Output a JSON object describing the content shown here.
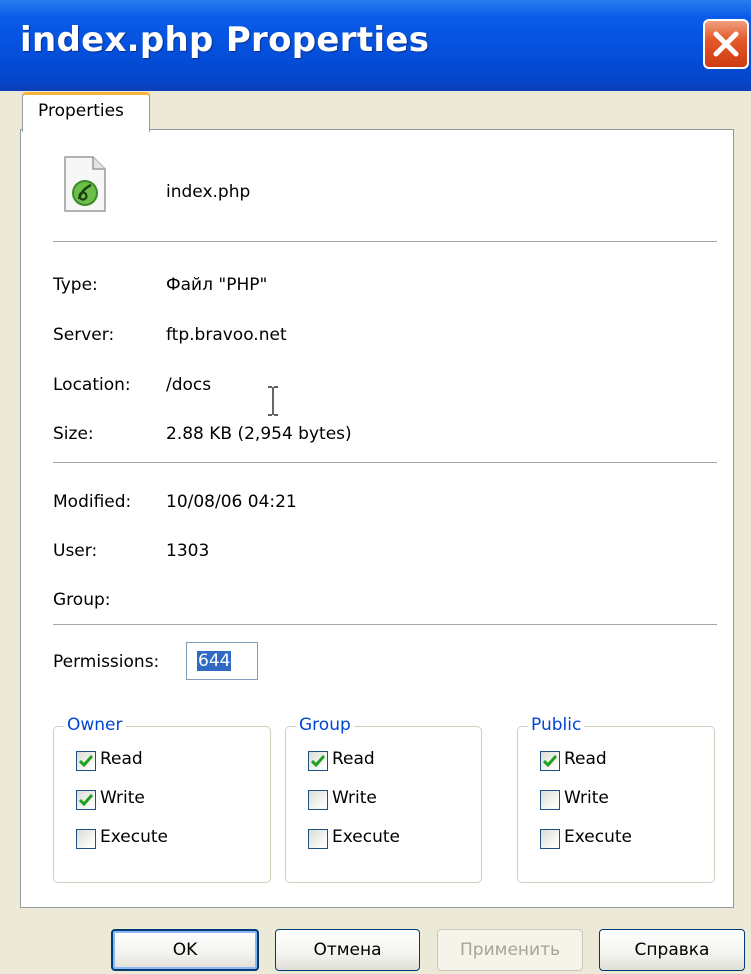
{
  "window": {
    "title": "index.php Properties"
  },
  "tabs": [
    {
      "label": "Properties"
    }
  ],
  "file": {
    "name": "index.php",
    "icon": "dreamweaver-php-file-icon"
  },
  "info": {
    "type_label": "Type:",
    "type_value": "Файл \"PHP\"",
    "server_label": "Server:",
    "server_value": "ftp.bravoo.net",
    "location_label": "Location:",
    "location_value": "/docs",
    "size_label": "Size:",
    "size_value": "2.88 KB (2,954 bytes)",
    "modified_label": "Modified:",
    "modified_value": "10/08/06 04:21",
    "user_label": "User:",
    "user_value": "1303",
    "group_label": "Group:",
    "group_value": ""
  },
  "permissions": {
    "label": "Permissions:",
    "value": "644",
    "owner": {
      "title": "Owner",
      "read_label": "Read",
      "read": true,
      "write_label": "Write",
      "write": true,
      "execute_label": "Execute",
      "execute": false
    },
    "group": {
      "title": "Group",
      "read_label": "Read",
      "read": true,
      "write_label": "Write",
      "write": false,
      "execute_label": "Execute",
      "execute": false
    },
    "public": {
      "title": "Public",
      "read_label": "Read",
      "read": true,
      "write_label": "Write",
      "write": false,
      "execute_label": "Execute",
      "execute": false
    }
  },
  "buttons": {
    "ok": "OK",
    "cancel": "Отмена",
    "apply": "Применить",
    "help": "Справка"
  },
  "colors": {
    "titlebar": "#0450dd",
    "group_title": "#0046d5",
    "checkmark": "#21a121",
    "selection": "#316ac5"
  }
}
